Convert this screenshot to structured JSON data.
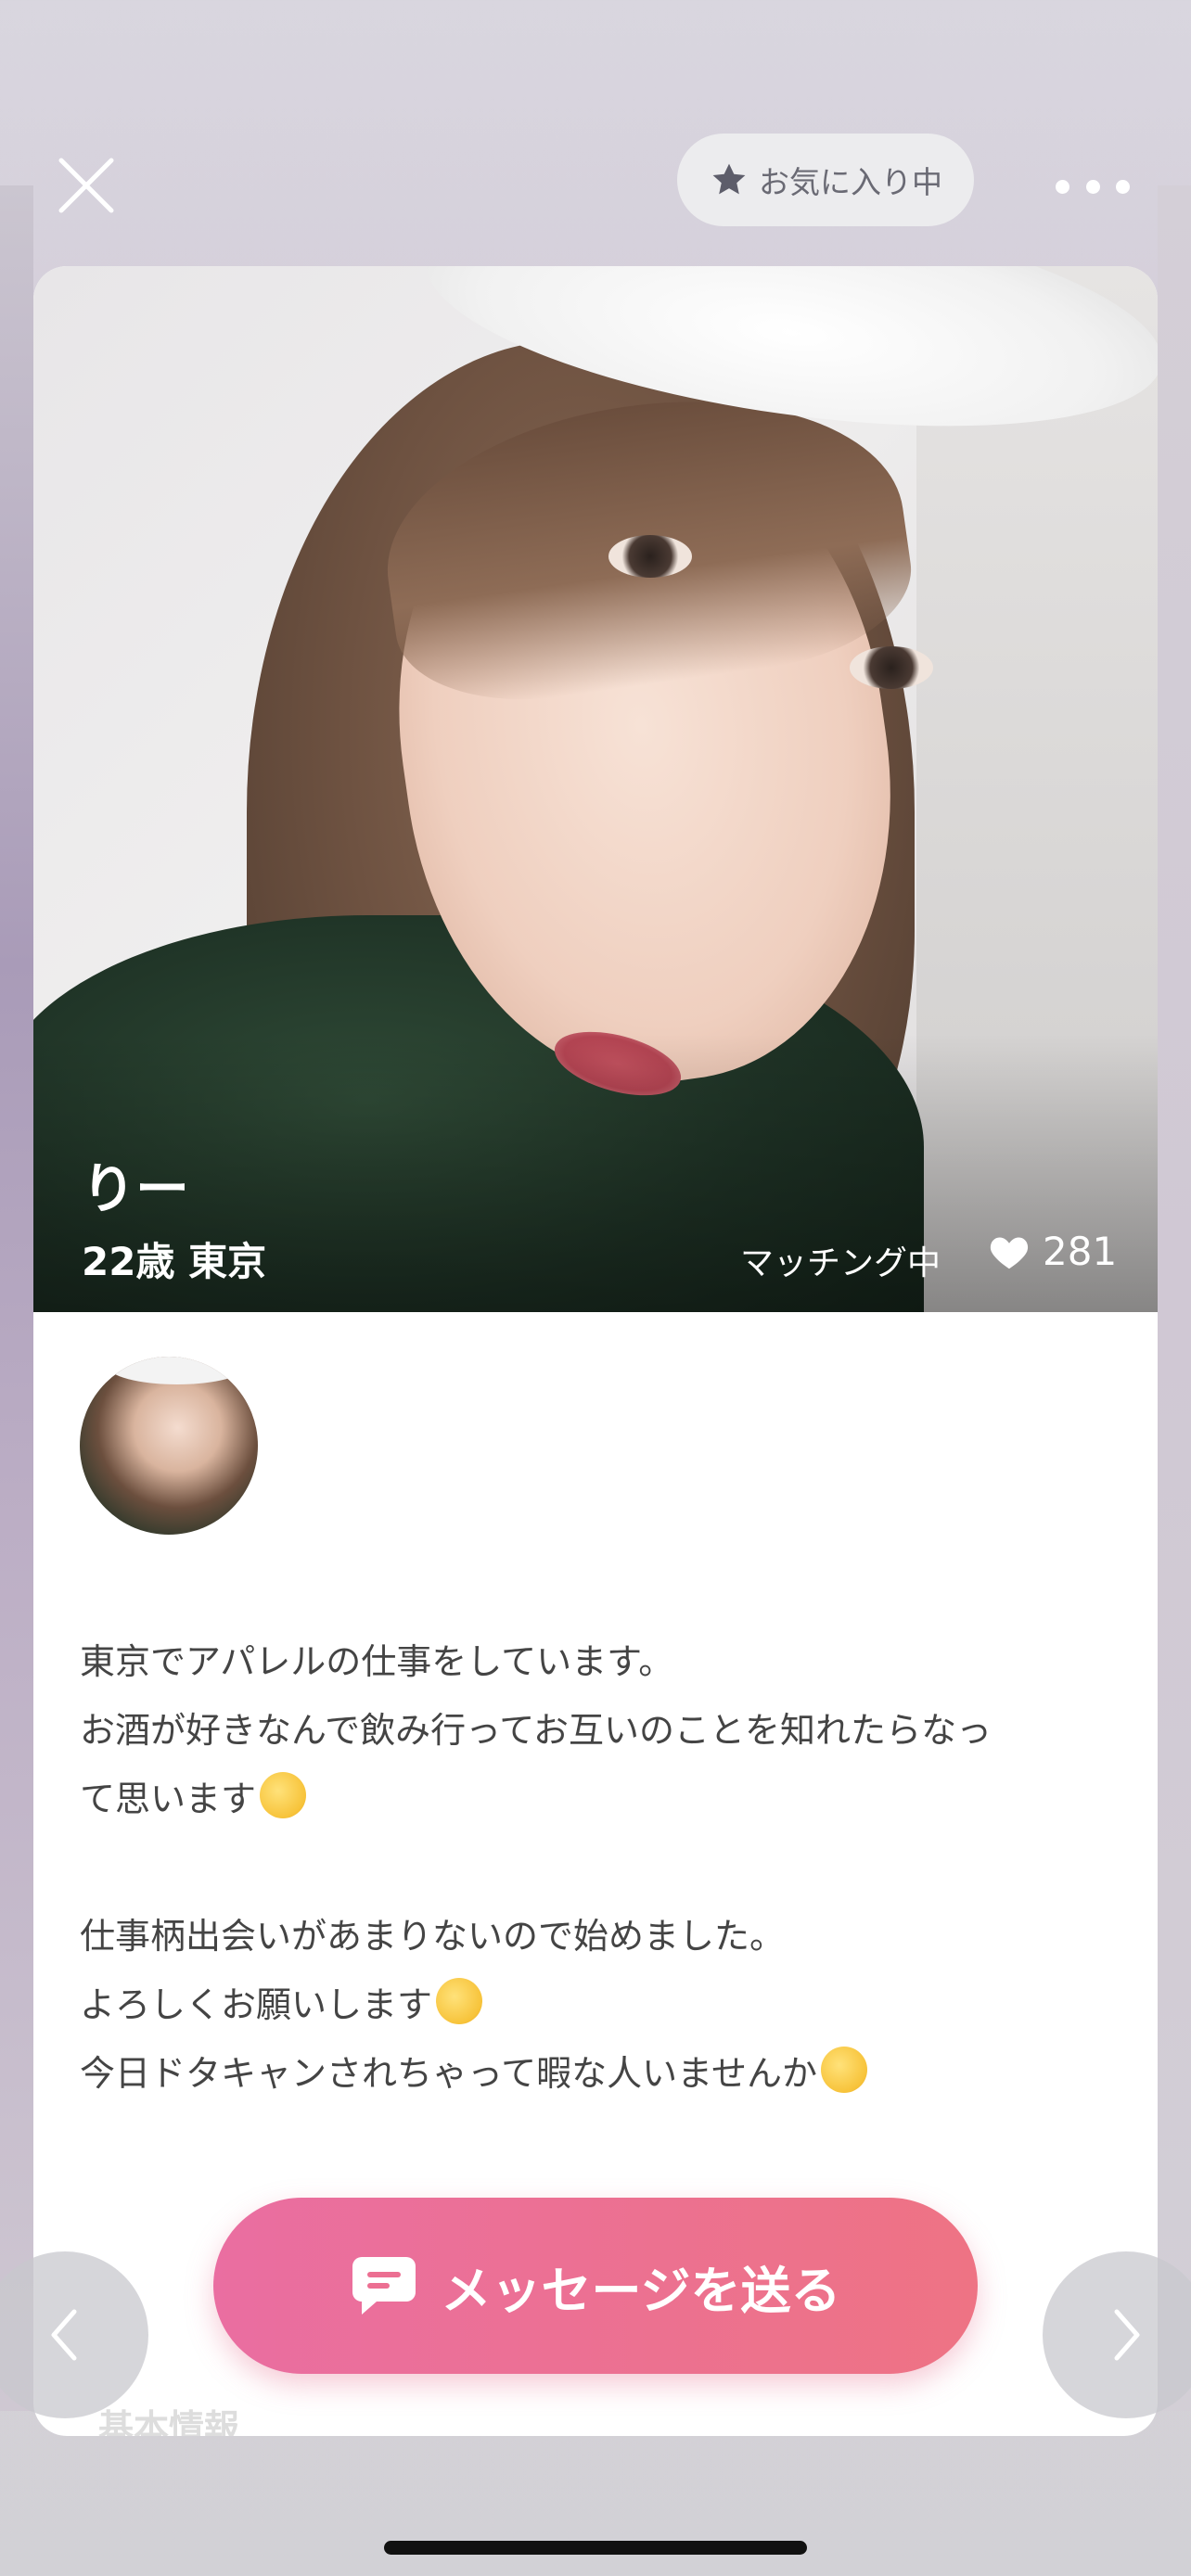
{
  "header": {
    "favorite_label": "お気に入り中"
  },
  "profile": {
    "name": "りー",
    "age_location": "22歳 東京",
    "status": "マッチング中",
    "likes": "281"
  },
  "bio": {
    "lines": [
      "東京でアパレルの仕事をしています。",
      "お酒が好きなんで飲み行ってお互いのことを知れたらなっ",
      "て思います",
      "",
      "仕事柄出会いがあまりないので始めました。",
      "よろしくお願いします",
      "今日ドタキャンされちゃって暇な人いませんか"
    ]
  },
  "section": {
    "basic_info": "基本情報"
  },
  "actions": {
    "send_message": "メッセージを送る"
  },
  "colors": {
    "accent_start": "#ea6ea1",
    "accent_end": "#ee7384"
  },
  "icons": [
    "close-icon",
    "star-icon",
    "more-icon",
    "heart-icon",
    "chat-icon",
    "chevron-left-icon",
    "chevron-right-icon"
  ]
}
